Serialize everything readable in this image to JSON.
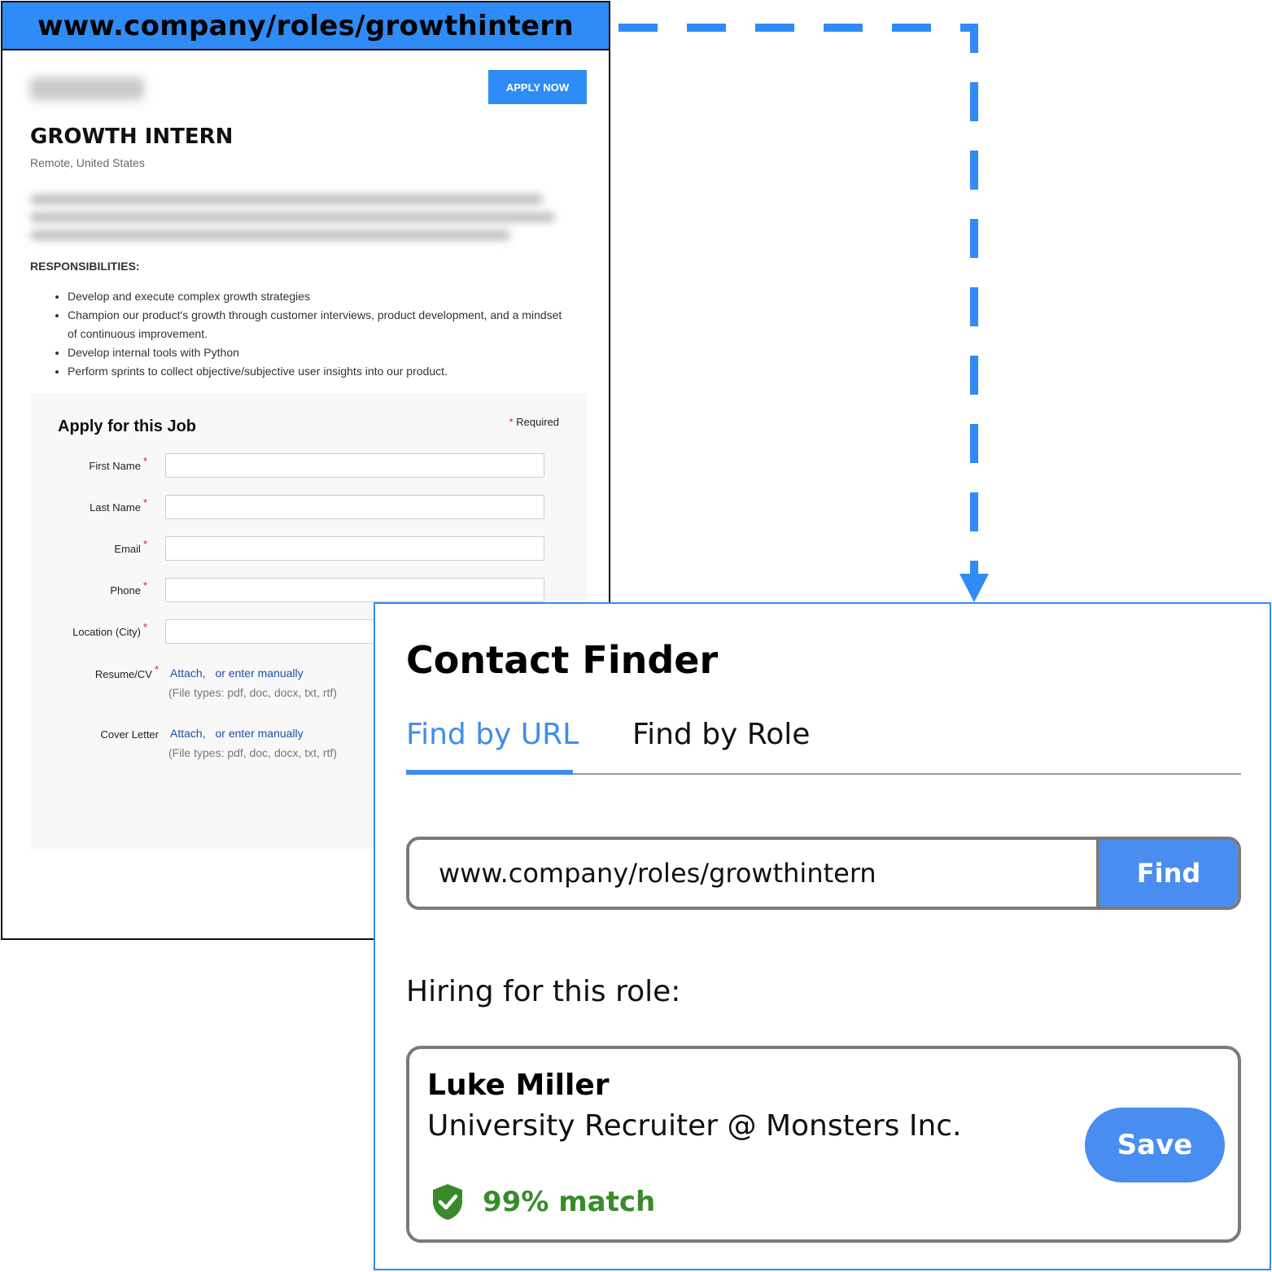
{
  "job_page": {
    "url": "www.company/roles/growthintern",
    "apply_now_label": "APPLY NOW",
    "title": "GROWTH INTERN",
    "location": "Remote, United States",
    "responsibilities_heading": "RESPONSIBILITIES:",
    "responsibilities": [
      "Develop and execute complex growth strategies",
      "Champion our product's growth through customer interviews, product development, and a mindset of continuous improvement.",
      "Develop internal tools with Python",
      "Perform sprints to collect objective/subjective user insights into our product."
    ],
    "apply_form": {
      "heading": "Apply for this Job",
      "required_star": "*",
      "required_note": "Required",
      "fields": [
        {
          "label": "First Name",
          "required": "*"
        },
        {
          "label": "Last Name",
          "required": "*"
        },
        {
          "label": "Email",
          "required": "*"
        },
        {
          "label": "Phone",
          "required": "*"
        },
        {
          "label": "Location (City)",
          "required": "*"
        }
      ],
      "attachments": [
        {
          "label": "Resume/CV",
          "required": "*",
          "attach": "Attach,",
          "manual": "or enter manually",
          "file_types": "(File types: pdf, doc, docx, txt, rtf)"
        },
        {
          "label": "Cover Letter",
          "required": "",
          "attach": "Attach,",
          "manual": "or enter manually",
          "file_types": "(File types: pdf, doc, docx, txt, rtf)"
        }
      ]
    }
  },
  "contact_finder": {
    "title": "Contact Finder",
    "tabs": [
      {
        "label": "Find by URL",
        "active": true
      },
      {
        "label": "Find by Role",
        "active": false
      }
    ],
    "search_value": "www.company/roles/growthintern",
    "find_label": "Find",
    "hiring_label": "Hiring for this role:",
    "contact": {
      "name": "Luke Miller",
      "role": "University Recruiter @ Monsters Inc.",
      "match": "99% match",
      "match_icon": "shield-check-icon",
      "save_label": "Save"
    }
  },
  "colors": {
    "accent_blue": "#2f8bf5",
    "button_blue": "#4a8df0",
    "match_green": "#3a8a2c",
    "required_red": "#e02020"
  }
}
